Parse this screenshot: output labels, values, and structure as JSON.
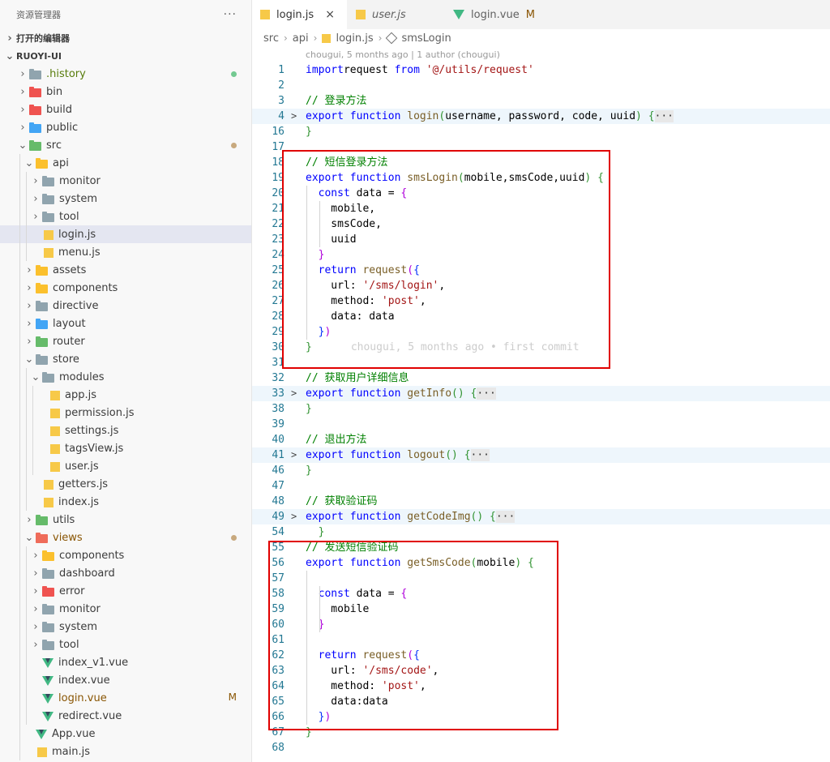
{
  "sidebar": {
    "title": "资源管理器",
    "more": "···",
    "open_editors": "打开的编辑器",
    "project": "RUOYI-UI",
    "tree": [
      {
        "label": ".history",
        "depth": 1,
        "kind": "folder",
        "color": "grey",
        "open": false,
        "badge": "dot-green",
        "style": "hist"
      },
      {
        "label": "bin",
        "depth": 1,
        "kind": "folder",
        "color": "red",
        "open": false
      },
      {
        "label": "build",
        "depth": 1,
        "kind": "folder",
        "color": "red",
        "open": false
      },
      {
        "label": "public",
        "depth": 1,
        "kind": "folder",
        "color": "blue",
        "open": false
      },
      {
        "label": "src",
        "depth": 1,
        "kind": "folder",
        "color": "green",
        "open": true,
        "badge": "dot-brown"
      },
      {
        "label": "api",
        "depth": 2,
        "kind": "folder",
        "color": "yellow",
        "open": true
      },
      {
        "label": "monitor",
        "depth": 3,
        "kind": "folder",
        "color": "grey",
        "open": false
      },
      {
        "label": "system",
        "depth": 3,
        "kind": "folder",
        "color": "grey",
        "open": false
      },
      {
        "label": "tool",
        "depth": 3,
        "kind": "folder",
        "color": "grey",
        "open": false
      },
      {
        "label": "login.js",
        "depth": 3,
        "kind": "js",
        "selected": true
      },
      {
        "label": "menu.js",
        "depth": 3,
        "kind": "js"
      },
      {
        "label": "assets",
        "depth": 2,
        "kind": "folder",
        "color": "yellow",
        "open": false
      },
      {
        "label": "components",
        "depth": 2,
        "kind": "folder",
        "color": "yellow",
        "open": false
      },
      {
        "label": "directive",
        "depth": 2,
        "kind": "folder",
        "color": "grey",
        "open": false
      },
      {
        "label": "layout",
        "depth": 2,
        "kind": "folder",
        "color": "blue",
        "open": false
      },
      {
        "label": "router",
        "depth": 2,
        "kind": "folder",
        "color": "green",
        "open": false
      },
      {
        "label": "store",
        "depth": 2,
        "kind": "folder",
        "color": "grey",
        "open": true
      },
      {
        "label": "modules",
        "depth": 3,
        "kind": "folder",
        "color": "grey",
        "open": true
      },
      {
        "label": "app.js",
        "depth": 4,
        "kind": "js"
      },
      {
        "label": "permission.js",
        "depth": 4,
        "kind": "js"
      },
      {
        "label": "settings.js",
        "depth": 4,
        "kind": "js"
      },
      {
        "label": "tagsView.js",
        "depth": 4,
        "kind": "js"
      },
      {
        "label": "user.js",
        "depth": 4,
        "kind": "js"
      },
      {
        "label": "getters.js",
        "depth": 3,
        "kind": "js"
      },
      {
        "label": "index.js",
        "depth": 3,
        "kind": "js"
      },
      {
        "label": "utils",
        "depth": 2,
        "kind": "folder",
        "color": "green",
        "open": false
      },
      {
        "label": "views",
        "depth": 2,
        "kind": "folder",
        "color": "redopen",
        "open": true,
        "badge": "dot-brown",
        "style": "mod"
      },
      {
        "label": "components",
        "depth": 3,
        "kind": "folder",
        "color": "yellow",
        "open": false
      },
      {
        "label": "dashboard",
        "depth": 3,
        "kind": "folder",
        "color": "grey",
        "open": false
      },
      {
        "label": "error",
        "depth": 3,
        "kind": "folder",
        "color": "red",
        "open": false
      },
      {
        "label": "monitor",
        "depth": 3,
        "kind": "folder",
        "color": "grey",
        "open": false
      },
      {
        "label": "system",
        "depth": 3,
        "kind": "folder",
        "color": "grey",
        "open": false
      },
      {
        "label": "tool",
        "depth": 3,
        "kind": "folder",
        "color": "grey",
        "open": false
      },
      {
        "label": "index_v1.vue",
        "depth": 3,
        "kind": "vue"
      },
      {
        "label": "index.vue",
        "depth": 3,
        "kind": "vue"
      },
      {
        "label": "login.vue",
        "depth": 3,
        "kind": "vue",
        "badge": "M",
        "style": "mod"
      },
      {
        "label": "redirect.vue",
        "depth": 3,
        "kind": "vue"
      },
      {
        "label": "App.vue",
        "depth": 2,
        "kind": "vue"
      },
      {
        "label": "main.js",
        "depth": 2,
        "kind": "js"
      }
    ]
  },
  "tabs": [
    {
      "label": "login.js",
      "icon": "js",
      "active": true,
      "close": "×"
    },
    {
      "label": "user.js",
      "icon": "js",
      "italic": true
    },
    {
      "label": "login.vue",
      "icon": "vue",
      "modified": "M"
    }
  ],
  "breadcrumb": [
    "src",
    "api",
    "login.js",
    "smsLogin"
  ],
  "blame": "chougui, 5 months ago | 1 author (chougui)",
  "code": [
    {
      "n": "1",
      "tokens": [
        [
          "kw",
          "import"
        ],
        [
          "",
          "request "
        ],
        [
          "kw",
          "from"
        ],
        [
          "",
          " "
        ],
        [
          "str",
          "'@/utils/request'"
        ]
      ]
    },
    {
      "n": "2",
      "tokens": []
    },
    {
      "n": "3",
      "tokens": [
        [
          "cm",
          "// 登录方法"
        ]
      ]
    },
    {
      "n": "4",
      "fold": ">",
      "hl": true,
      "tokens": [
        [
          "kw",
          "export"
        ],
        [
          "",
          " "
        ],
        [
          "kw",
          "function"
        ],
        [
          "",
          " "
        ],
        [
          "fn",
          "login"
        ],
        [
          "br2",
          "("
        ],
        [
          "",
          "username, password, code, uuid"
        ],
        [
          "br2",
          ")"
        ],
        [
          "",
          " "
        ],
        [
          "br2",
          "{"
        ],
        [
          "ell",
          "···"
        ]
      ]
    },
    {
      "n": "16",
      "tokens": [
        [
          "br2",
          "}"
        ]
      ]
    },
    {
      "n": "17",
      "tokens": []
    },
    {
      "n": "18",
      "tokens": [
        [
          "cm",
          "// 短信登录方法"
        ]
      ]
    },
    {
      "n": "19",
      "tokens": [
        [
          "kw",
          "export"
        ],
        [
          "",
          " "
        ],
        [
          "kw",
          "function"
        ],
        [
          "",
          " "
        ],
        [
          "fn",
          "smsLogin"
        ],
        [
          "br2",
          "("
        ],
        [
          "",
          "mobile,smsCode,uuid"
        ],
        [
          "br2",
          ")"
        ],
        [
          "",
          " "
        ],
        [
          "br2",
          "{"
        ]
      ]
    },
    {
      "n": "20",
      "tokens": [
        [
          "",
          "  "
        ],
        [
          "kw",
          "const"
        ],
        [
          "",
          " data = "
        ],
        [
          "br3",
          "{"
        ]
      ]
    },
    {
      "n": "21",
      "tokens": [
        [
          "",
          "    mobile,"
        ]
      ]
    },
    {
      "n": "22",
      "tokens": [
        [
          "",
          "    smsCode,"
        ]
      ]
    },
    {
      "n": "23",
      "tokens": [
        [
          "",
          "    uuid"
        ]
      ]
    },
    {
      "n": "24",
      "tokens": [
        [
          "",
          "  "
        ],
        [
          "br3",
          "}"
        ]
      ]
    },
    {
      "n": "25",
      "tokens": [
        [
          "",
          "  "
        ],
        [
          "kw",
          "return"
        ],
        [
          "",
          " "
        ],
        [
          "fn",
          "request"
        ],
        [
          "br3",
          "("
        ],
        [
          "br1",
          "{"
        ]
      ]
    },
    {
      "n": "26",
      "tokens": [
        [
          "",
          "    url: "
        ],
        [
          "str",
          "'/sms/login'"
        ],
        [
          "",
          ","
        ]
      ]
    },
    {
      "n": "27",
      "tokens": [
        [
          "",
          "    method: "
        ],
        [
          "str",
          "'post'"
        ],
        [
          "",
          ","
        ]
      ]
    },
    {
      "n": "28",
      "tokens": [
        [
          "",
          "    data: data"
        ]
      ]
    },
    {
      "n": "29",
      "tokens": [
        [
          "",
          "  "
        ],
        [
          "br1",
          "}"
        ],
        [
          "br3",
          ")"
        ]
      ]
    },
    {
      "n": "30",
      "tokens": [
        [
          "br2",
          "}"
        ],
        [
          "ghost",
          "chougui, 5 months ago • first commit"
        ]
      ]
    },
    {
      "n": "31",
      "tokens": []
    },
    {
      "n": "32",
      "tokens": [
        [
          "cm",
          "// 获取用户详细信息"
        ]
      ]
    },
    {
      "n": "33",
      "fold": ">",
      "hl": true,
      "tokens": [
        [
          "kw",
          "export"
        ],
        [
          "",
          " "
        ],
        [
          "kw",
          "function"
        ],
        [
          "",
          " "
        ],
        [
          "fn",
          "getInfo"
        ],
        [
          "br2",
          "()"
        ],
        [
          "",
          " "
        ],
        [
          "br2",
          "{"
        ],
        [
          "ell",
          "···"
        ]
      ]
    },
    {
      "n": "38",
      "tokens": [
        [
          "br2",
          "}"
        ]
      ]
    },
    {
      "n": "39",
      "tokens": []
    },
    {
      "n": "40",
      "tokens": [
        [
          "cm",
          "// 退出方法"
        ]
      ]
    },
    {
      "n": "41",
      "fold": ">",
      "hl": true,
      "tokens": [
        [
          "kw",
          "export"
        ],
        [
          "",
          " "
        ],
        [
          "kw",
          "function"
        ],
        [
          "",
          " "
        ],
        [
          "fn",
          "logout"
        ],
        [
          "br2",
          "()"
        ],
        [
          "",
          " "
        ],
        [
          "br2",
          "{"
        ],
        [
          "ell",
          "···"
        ]
      ]
    },
    {
      "n": "46",
      "tokens": [
        [
          "br2",
          "}"
        ]
      ]
    },
    {
      "n": "47",
      "tokens": []
    },
    {
      "n": "48",
      "tokens": [
        [
          "cm",
          "// 获取验证码"
        ]
      ]
    },
    {
      "n": "49",
      "fold": ">",
      "hl": true,
      "tokens": [
        [
          "kw",
          "export"
        ],
        [
          "",
          " "
        ],
        [
          "kw",
          "function"
        ],
        [
          "",
          " "
        ],
        [
          "fn",
          "getCodeImg"
        ],
        [
          "br2",
          "()"
        ],
        [
          "",
          " "
        ],
        [
          "br2",
          "{"
        ],
        [
          "ell",
          "···"
        ]
      ]
    },
    {
      "n": "54",
      "tokens": [
        [
          "",
          "  "
        ],
        [
          "br2",
          "}"
        ]
      ]
    },
    {
      "n": "55",
      "tokens": [
        [
          "cm",
          "// 发送短信验证码"
        ]
      ]
    },
    {
      "n": "56",
      "tokens": [
        [
          "kw",
          "export"
        ],
        [
          "",
          " "
        ],
        [
          "kw",
          "function"
        ],
        [
          "",
          " "
        ],
        [
          "fn",
          "getSmsCode"
        ],
        [
          "br2",
          "("
        ],
        [
          "",
          "mobile"
        ],
        [
          "br2",
          ")"
        ],
        [
          "",
          " "
        ],
        [
          "br2",
          "{"
        ]
      ]
    },
    {
      "n": "57",
      "tokens": []
    },
    {
      "n": "58",
      "tokens": [
        [
          "",
          "  "
        ],
        [
          "kw",
          "const"
        ],
        [
          "",
          " data = "
        ],
        [
          "br3",
          "{"
        ]
      ]
    },
    {
      "n": "59",
      "tokens": [
        [
          "",
          "    mobile"
        ]
      ]
    },
    {
      "n": "60",
      "tokens": [
        [
          "",
          "  "
        ],
        [
          "br3",
          "}"
        ]
      ]
    },
    {
      "n": "61",
      "tokens": []
    },
    {
      "n": "62",
      "tokens": [
        [
          "",
          "  "
        ],
        [
          "kw",
          "return"
        ],
        [
          "",
          " "
        ],
        [
          "fn",
          "request"
        ],
        [
          "br3",
          "("
        ],
        [
          "br1",
          "{"
        ]
      ]
    },
    {
      "n": "63",
      "tokens": [
        [
          "",
          "    url: "
        ],
        [
          "str",
          "'/sms/code'"
        ],
        [
          "",
          ","
        ]
      ]
    },
    {
      "n": "64",
      "tokens": [
        [
          "",
          "    method: "
        ],
        [
          "str",
          "'post'"
        ],
        [
          "",
          ","
        ]
      ]
    },
    {
      "n": "65",
      "tokens": [
        [
          "",
          "    data:data"
        ]
      ]
    },
    {
      "n": "66",
      "tokens": [
        [
          "",
          "  "
        ],
        [
          "br1",
          "}"
        ],
        [
          "br3",
          ")"
        ]
      ]
    },
    {
      "n": "67",
      "tokens": [
        [
          "br2",
          "}"
        ]
      ]
    },
    {
      "n": "68",
      "tokens": []
    }
  ],
  "colors": {
    "highlight_box": "#e00000",
    "keyword": "#0000ff",
    "string": "#a31515",
    "comment": "#008000",
    "function": "#795e26"
  }
}
